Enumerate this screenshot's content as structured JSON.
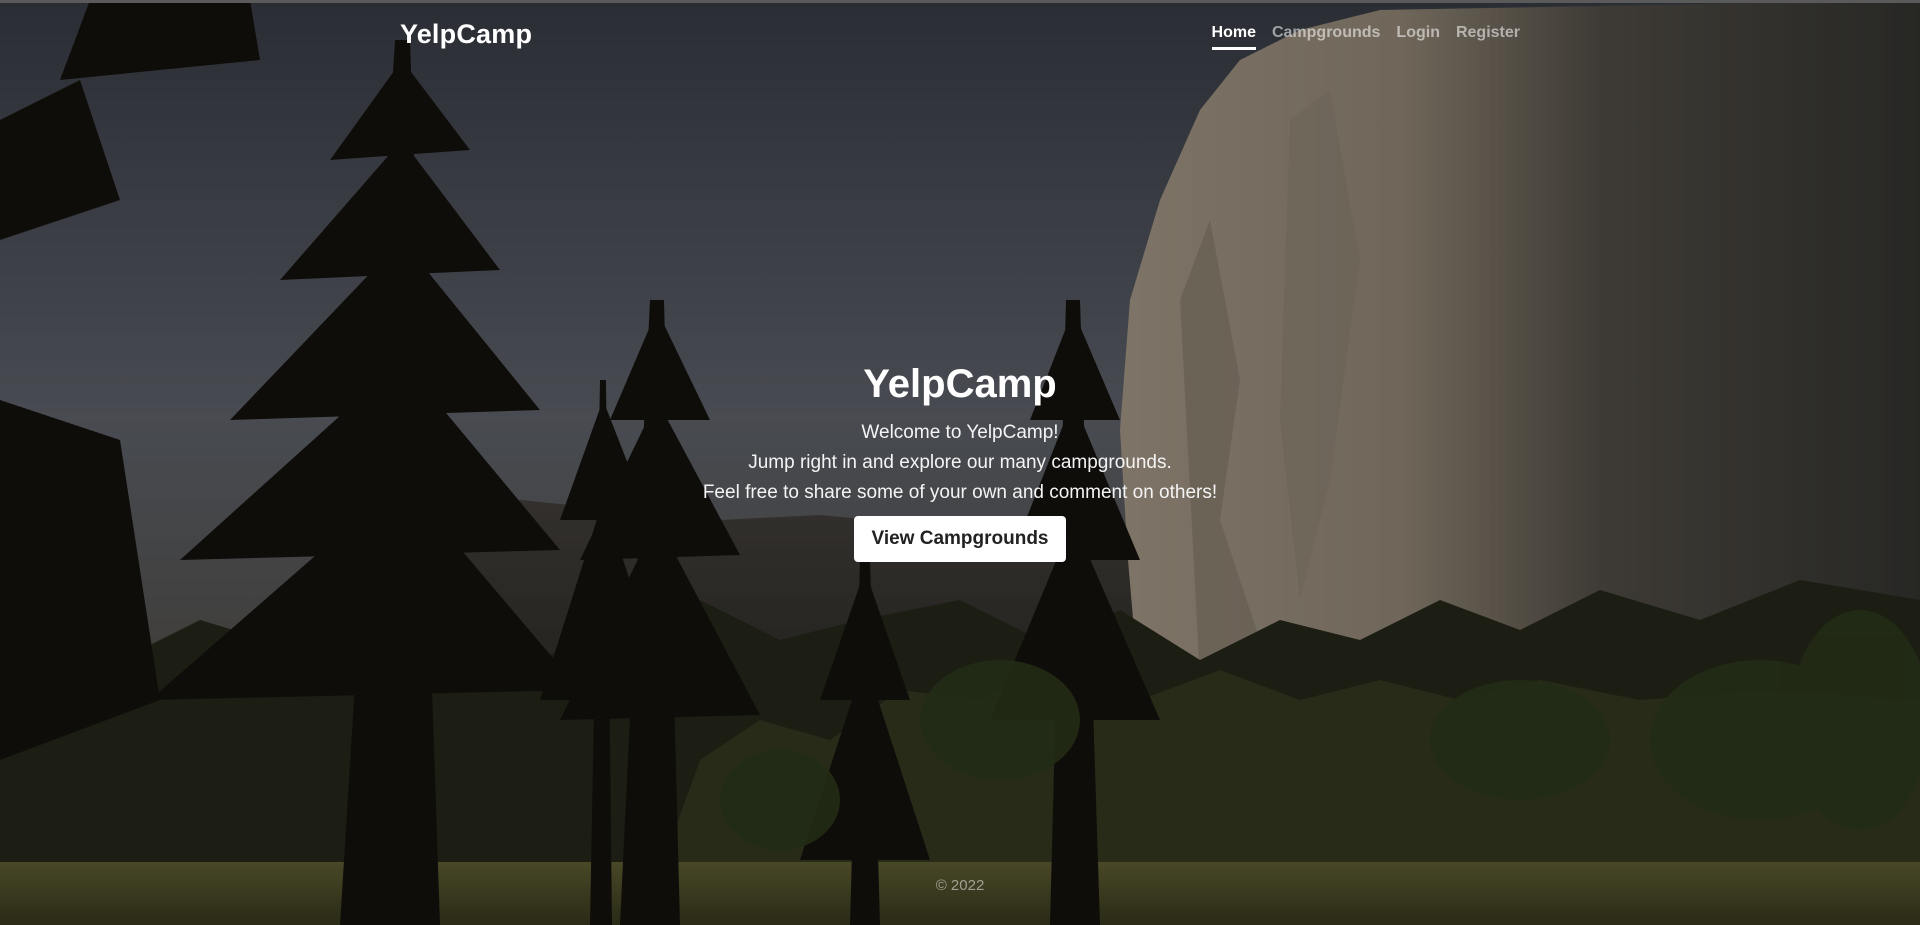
{
  "brand": "YelpCamp",
  "nav": {
    "items": [
      {
        "label": "Home",
        "active": true
      },
      {
        "label": "Campgrounds",
        "active": false
      },
      {
        "label": "Login",
        "active": false
      },
      {
        "label": "Register",
        "active": false
      }
    ]
  },
  "hero": {
    "title": "YelpCamp",
    "line1": "Welcome to YelpCamp!",
    "line2": "Jump right in and explore our many campgrounds.",
    "line3": "Feel free to share some of your own and comment on others!",
    "button_label": "View Campgrounds"
  },
  "footer": {
    "text": "© 2022"
  },
  "colors": {
    "text": "#ffffff",
    "button_bg": "#ffffff",
    "button_text": "#222222"
  }
}
